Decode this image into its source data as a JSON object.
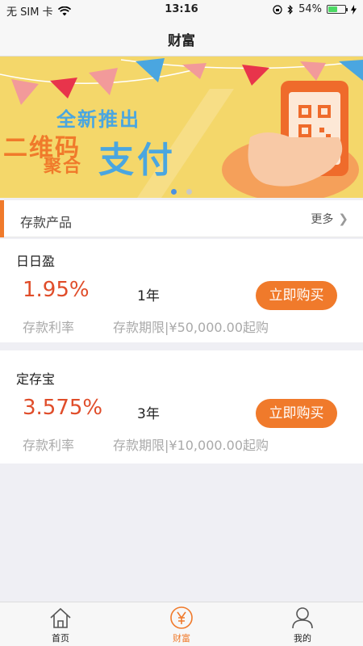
{
  "status_bar": {
    "carrier": "无 SIM 卡",
    "time": "13:16",
    "battery": "54%",
    "battery_level": 0.54
  },
  "nav": {
    "title": "财富"
  },
  "banner": {
    "subtitle": "全新推出",
    "line1": "二维码",
    "line2": "聚合",
    "headline": "支付",
    "page_count": 2,
    "active_page": 0
  },
  "section": {
    "title": "存款产品",
    "more": "更多"
  },
  "products": [
    {
      "name": "日日盈",
      "rate": "1.95%",
      "term": "1年",
      "buy_label": "立即购买",
      "rate_label": "存款利率",
      "term_label": "存款期限|¥50,000.00起购"
    },
    {
      "name": "定存宝",
      "rate": "3.575%",
      "term": "3年",
      "buy_label": "立即购买",
      "rate_label": "存款利率",
      "term_label": "存款期限|¥10,000.00起购"
    }
  ],
  "tabs": [
    {
      "label": "首页",
      "icon": "home-icon",
      "active": false
    },
    {
      "label": "财富",
      "icon": "yen-icon",
      "active": true
    },
    {
      "label": "我的",
      "icon": "user-icon",
      "active": false
    }
  ],
  "colors": {
    "accent": "#f07a2b",
    "rate": "#e04d2a",
    "banner_bg": "#f4d76a"
  }
}
